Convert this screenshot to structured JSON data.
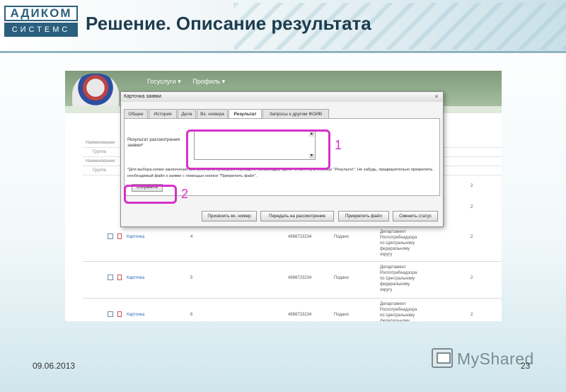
{
  "slide": {
    "title": "Решение. Описание результата",
    "date": "09.06.2013",
    "page_number": "23",
    "logo_top": "АДИКОМ",
    "logo_bottom": "СИСТЕМС",
    "brand": "MyShared"
  },
  "portal": {
    "nav": [
      "Госуслуги ▾",
      "Профиль ▾"
    ]
  },
  "dialog": {
    "title": "Карточка заявки",
    "close": "×",
    "tabs": [
      "Общее",
      "История",
      "Дела",
      "Вх. номера",
      "Результат",
      "Запросы к другим ФОИВ"
    ],
    "active_tab_index": 4,
    "field_label": "Результат рассмотрения заявки*",
    "note": "*Для выбора копии заключения (ЭЭ (или акта проверки) перейдите на закладку \"Дело\" и на ... ку в столбце \"Результат\". Не забудь, предварительно прикрепить необходимый файл к заявке с помощью кнопки \"Прикрепить файл\".",
    "save_label": "Сохранить",
    "actions": [
      "Присвоить вх. номер",
      "Передать на рассмотрение",
      "Прикрепить файл",
      "Сменить статус"
    ]
  },
  "table": {
    "group_rows": [
      "Наименование",
      "Группа",
      "Наименование",
      "Группа"
    ],
    "rows": [
      {
        "link": "Карточка",
        "num": "4",
        "phone": "4998723234",
        "status": "Подано",
        "dept": "Департамент Роспотребнадзора по Центральному федеральному округу",
        "last": "2"
      },
      {
        "link": "Карточка",
        "num": "5",
        "phone": "4998723234",
        "status": "Подано",
        "dept": "Департамент Роспотребнадзора по Центральному федеральному округу",
        "last": "2"
      },
      {
        "link": "Карточка",
        "num": "6",
        "phone": "4998723234",
        "status": "Подано",
        "dept": "Департамент Роспотребнадзора по Центральному федеральному округу",
        "last": "2"
      }
    ],
    "right_col_values": [
      "2",
      "2"
    ]
  },
  "annotations": {
    "num1": "1",
    "num2": "2",
    "color": "#d631c9"
  }
}
